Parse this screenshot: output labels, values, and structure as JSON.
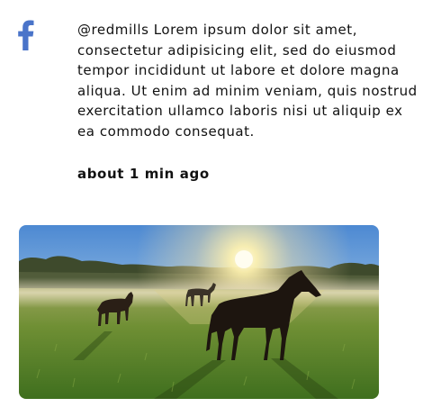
{
  "post": {
    "text": "@redmills Lorem ipsum dolor sit amet, consectetur adipisicing elit, sed do eiusmod tempor incididunt ut labore et dolore magna aliqua. Ut enim ad minim veniam, quis nostrud exercitation ullamco laboris nisi ut aliquip ex ea commodo consequat.",
    "timestamp": "about 1 min ago"
  },
  "icons": {
    "network": "facebook-icon"
  },
  "colors": {
    "facebook_blue": "#4a74c9",
    "text": "#111111"
  }
}
